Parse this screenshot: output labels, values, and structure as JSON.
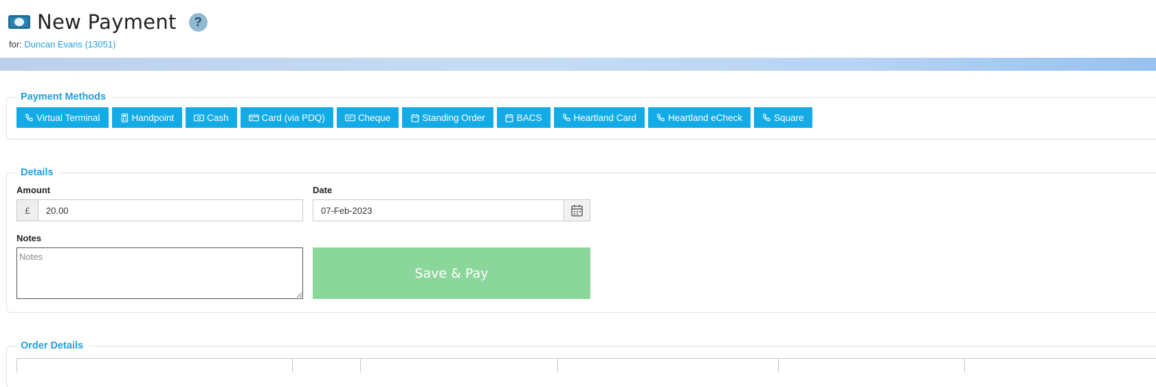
{
  "header": {
    "title": "New Payment",
    "help_label": "?",
    "for_prefix": "for:",
    "customer_link": "Duncan Evans (13051)"
  },
  "payment_methods": {
    "legend": "Payment Methods",
    "buttons": [
      {
        "label": "Virtual Terminal",
        "icon": "phone-icon"
      },
      {
        "label": "Handpoint",
        "icon": "calculator-icon"
      },
      {
        "label": "Cash",
        "icon": "cash-icon"
      },
      {
        "label": "Card (via PDQ)",
        "icon": "credit-card-icon"
      },
      {
        "label": "Cheque",
        "icon": "cheque-icon"
      },
      {
        "label": "Standing Order",
        "icon": "calendar-icon"
      },
      {
        "label": "BACS",
        "icon": "calendar-icon"
      },
      {
        "label": "Heartland Card",
        "icon": "phone-icon"
      },
      {
        "label": "Heartland eCheck",
        "icon": "phone-icon"
      },
      {
        "label": "Square",
        "icon": "phone-icon"
      }
    ]
  },
  "details": {
    "legend": "Details",
    "amount_label": "Amount",
    "currency_symbol": "£",
    "amount_value": "20.00",
    "date_label": "Date",
    "date_value": "07-Feb-2023",
    "notes_label": "Notes",
    "notes_placeholder": "Notes",
    "save_label": "Save & Pay"
  },
  "order_details": {
    "legend": "Order Details"
  },
  "colors": {
    "accent": "#13abe6",
    "save_button": "#8bd69b",
    "link": "#1ea0dc"
  }
}
